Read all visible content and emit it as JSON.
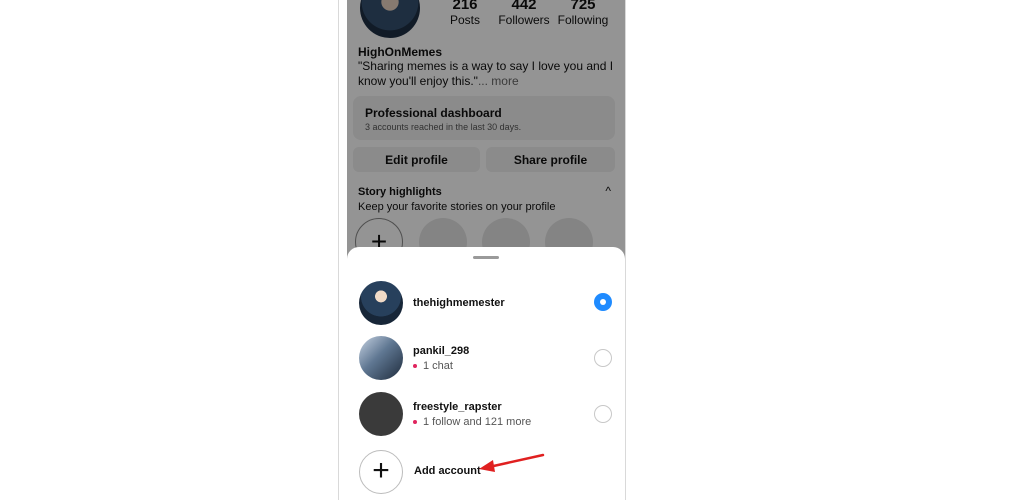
{
  "profile": {
    "stats": [
      {
        "value": "216",
        "label": "Posts"
      },
      {
        "value": "442",
        "label": "Followers"
      },
      {
        "value": "725",
        "label": "Following"
      }
    ],
    "username": "HighOnMemes",
    "bio": "\"Sharing memes is a way to say I love you and I know you'll enjoy this.\"",
    "bio_more": "... more",
    "dashboard_title": "Professional dashboard",
    "dashboard_subtitle": "3 accounts reached in the last 30 days.",
    "edit_profile": "Edit profile",
    "share_profile": "Share profile",
    "highlights_title": "Story highlights",
    "highlights_caret": "^",
    "highlights_subtitle": "Keep your favorite stories on your profile",
    "new_highlight_icon": "+"
  },
  "account_switcher": {
    "accounts": [
      {
        "name": "thehighmemester",
        "note": "",
        "selected": true,
        "avatar_icon": "profile-photo"
      },
      {
        "name": "pankil_298",
        "note": "1 chat",
        "selected": false,
        "avatar_icon": "profile-photo"
      },
      {
        "name": "freestyle_rapster",
        "note": "1 follow and 121 more",
        "selected": false,
        "avatar_icon": "default-avatar"
      }
    ],
    "add_icon": "+",
    "add_label": "Add account",
    "annotation_arrow_color": "#e02020"
  },
  "colors": {
    "accent": "#1f8bff",
    "notification_dot": "#e0245e"
  }
}
